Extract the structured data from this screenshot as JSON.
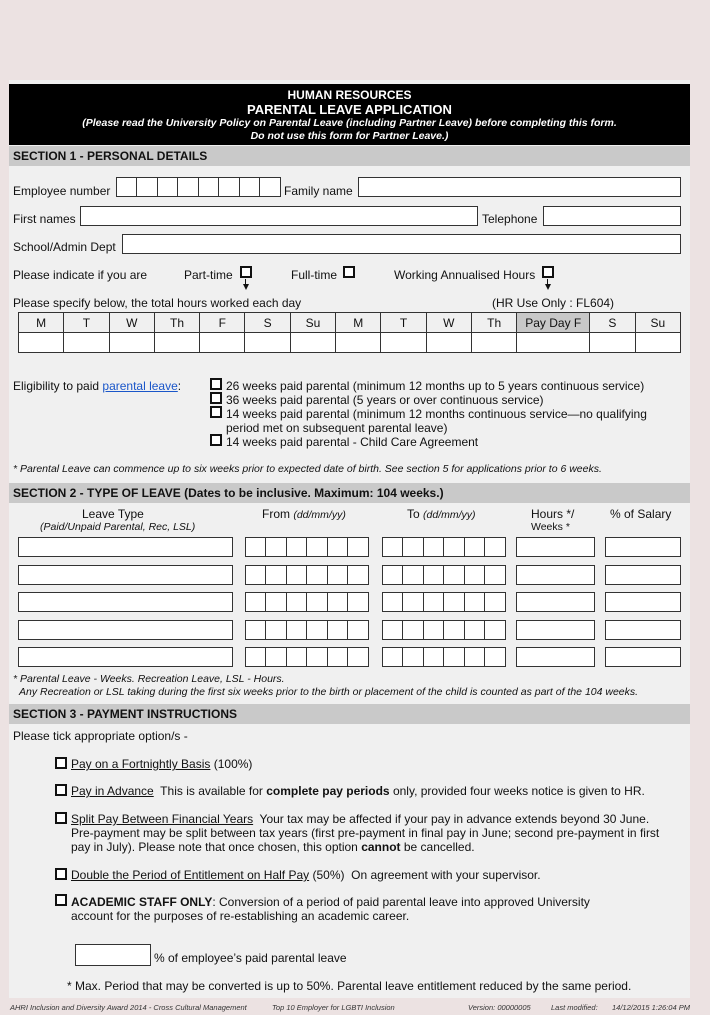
{
  "header": {
    "department": "HUMAN RESOURCES",
    "title": "PARENTAL LEAVE APPLICATION",
    "note_line1": "(Please read the University Policy on Parental Leave (including Partner Leave) before completing this form.",
    "note_line2": "Do not use this form for Partner Leave.)"
  },
  "section1": {
    "title": "SECTION 1 - PERSONAL DETAILS",
    "employee_number_label": "Employee number",
    "employee_number_digits": 8,
    "family_name_label": "Family name",
    "first_names_label": "First names",
    "telephone_label": "Telephone",
    "school_label": "School/Admin Dept",
    "indicate_label": "Please indicate if you are",
    "part_time_label": "Part-time",
    "full_time_label": "Full-time",
    "annualised_label": "Working Annualised Hours",
    "hours_label": "Please specify below, the total hours worked each day",
    "hr_use_label": "(HR Use Only : FL604)",
    "days": [
      "M",
      "T",
      "W",
      "Th",
      "F",
      "S",
      "Su",
      "M",
      "T",
      "W",
      "Th",
      "Pay Day F",
      "S",
      "Su"
    ],
    "eligibility_prefix": "Eligibility to paid ",
    "eligibility_link": "parental leave",
    "eligibility_suffix": ":",
    "eligibility_options": [
      "26 weeks paid parental (minimum 12 months up to 5 years continuous service)",
      "36 weeks paid parental (5 years or over continuous service)",
      "14 weeks paid parental (minimum 12 months continuous service—no qualifying",
      "period met on subsequent parental leave)",
      "14 weeks paid parental - Child Care Agreement"
    ],
    "footnote": "* Parental Leave can commence up to six weeks prior to expected date of birth.  See section 5 for applications prior to 6 weeks."
  },
  "section2": {
    "title": "SECTION 2 - TYPE OF LEAVE (Dates to be inclusive. Maximum: 104 weeks.)",
    "col_leave_type": "Leave Type",
    "col_leave_type_sub": "(Paid/Unpaid Parental, Rec, LSL)",
    "col_from": "From ",
    "col_from_fmt": "(dd/mm/yy)",
    "col_to": "To ",
    "col_to_fmt": "(dd/mm/yy)",
    "col_hours": "Hours */",
    "col_hours2": "Weeks *",
    "col_salary": "% of Salary",
    "row_count": 5,
    "note1": "* Parental Leave - Weeks. Recreation Leave, LSL - Hours.",
    "note2": "Any Recreation or LSL taking during the first six weeks prior to the birth or placement of the child is counted as part of the 104 weeks."
  },
  "section3": {
    "title": "SECTION 3 - PAYMENT INSTRUCTIONS",
    "intro": "Please tick appropriate option/s -",
    "opt1_link": "Pay on a Fortnightly Basis",
    "opt1_rest": " (100%)",
    "opt2_link": "Pay in Advance",
    "opt2_a": "  This is available for ",
    "opt2_bold": "complete pay periods",
    "opt2_b": " only, provided four weeks notice is given to HR.",
    "opt3_link": "Split Pay Between Financial Years",
    "opt3_a": "  Your tax may be affected if your pay in advance extends beyond 30 June.",
    "opt3_line2": "Pre-payment may be split between tax years (first pre-payment in final pay in June; second pre-payment in first",
    "opt3_line3a": "pay in July). Please note that once chosen, this option ",
    "opt3_bold": "cannot",
    "opt3_line3b": " be cancelled.",
    "opt4_link": "Double the Period of Entitlement on Half Pay",
    "opt4_rest": " (50%)  On agreement with your supervisor.",
    "opt5_bold": "ACADEMIC STAFF ONLY",
    "opt5_rest": ": Conversion of a period of paid parental leave into approved University",
    "opt5_line2": "account for the purposes of re-establishing an academic career.",
    "percent_label": "% of employee’s paid parental leave",
    "max_note": "* Max. Period that may be converted is up to 50%. Parental leave entitlement reduced by the same period."
  },
  "footer": {
    "award": "AHRI Inclusion and Diversity Award 2014 - Cross Cultural Management",
    "employer": "Top 10 Employer for LGBTI Inclusion",
    "version": "Version: 00000005",
    "modified_label": "Last modified:",
    "modified_value": "14/12/2015 1:26:04 PM"
  }
}
